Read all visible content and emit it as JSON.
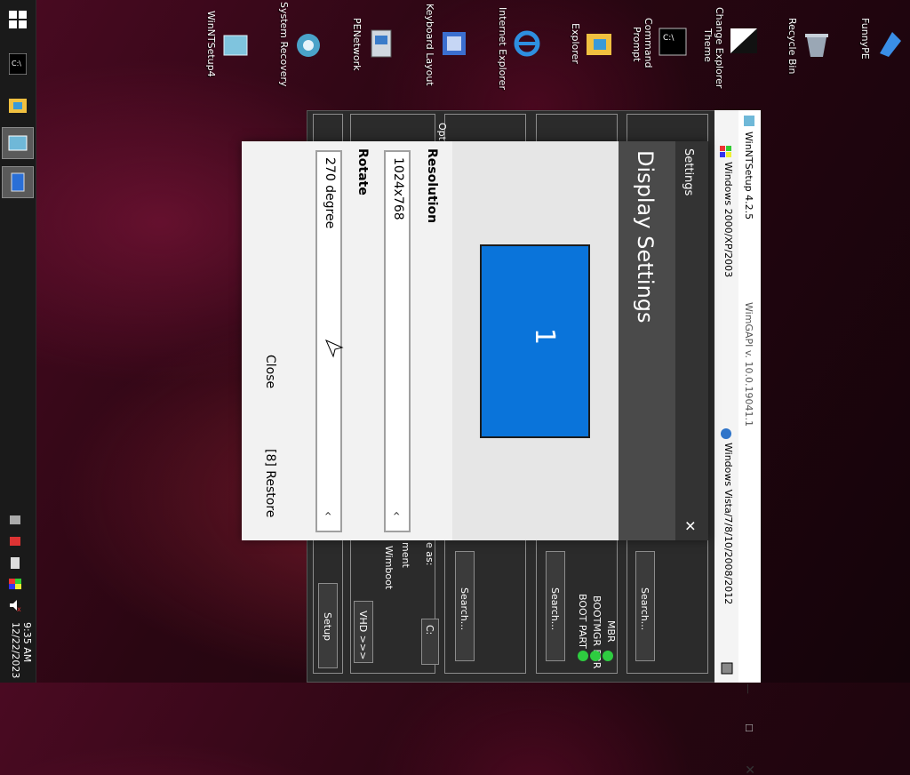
{
  "desktop": {
    "icons": [
      {
        "label": "FunnyPE",
        "icon": "funnype-icon"
      },
      {
        "label": "Recycle Bin",
        "icon": "recycle-bin-icon"
      },
      {
        "label": "Change Explorer Theme",
        "icon": "theme-icon"
      },
      {
        "label": "Command Prompt",
        "icon": "cmd-icon"
      },
      {
        "label": "Explorer",
        "icon": "folder-icon"
      },
      {
        "label": "Internet Explorer",
        "icon": "ie-icon"
      },
      {
        "label": "Keyboard Layout",
        "icon": "keyboard-icon"
      },
      {
        "label": "PENetwork",
        "icon": "network-icon"
      },
      {
        "label": "System Recovery",
        "icon": "recovery-icon"
      },
      {
        "label": "WinNTSetup4",
        "icon": "winntsetup-icon"
      }
    ]
  },
  "taskbar": {
    "time": "9:35 AM",
    "date": "12/22/2023"
  },
  "app": {
    "title": "WinNTSetup 4.2.5",
    "header_left": "Windows 2000/XP/2003",
    "wimgapi": "WimGAPI v. 10.0.19041.1",
    "header_right": "Windows Vista/7/8/10/2008/2012",
    "search_label": "Search...",
    "boot_labels": [
      "MBR",
      "BOOTMGR PBR",
      "BOOT PART"
    ],
    "mount_label": "e as:",
    "drive_letter": "C:",
    "wimboot": "Wimboot",
    "comment": "ment",
    "options_label": "Opt",
    "vhd": "VHD >>>",
    "setup": "Setup"
  },
  "dialog": {
    "settings_label": "Settings",
    "title": "Display Settings",
    "monitor_number": "1",
    "resolution_label": "Resolution",
    "resolution_value": "1024x768",
    "rotate_label": "Rotate",
    "rotate_value": "270 degree",
    "close_label": "Close",
    "restore_label": "[8] Restore"
  },
  "colors": {
    "accent": "#0a74da",
    "status_green": "#2ecc40"
  }
}
